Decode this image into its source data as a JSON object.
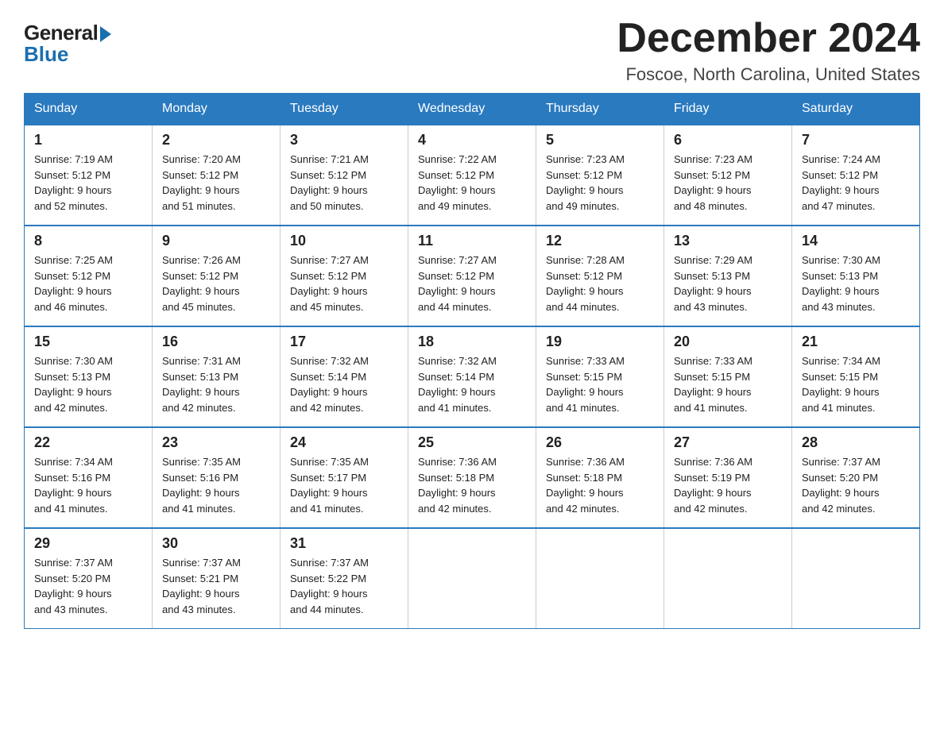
{
  "logo": {
    "general": "General",
    "blue": "Blue"
  },
  "title": "December 2024",
  "subtitle": "Foscoe, North Carolina, United States",
  "days_of_week": [
    "Sunday",
    "Monday",
    "Tuesday",
    "Wednesday",
    "Thursday",
    "Friday",
    "Saturday"
  ],
  "weeks": [
    [
      {
        "day": "1",
        "sunrise": "7:19 AM",
        "sunset": "5:12 PM",
        "daylight": "9 hours and 52 minutes."
      },
      {
        "day": "2",
        "sunrise": "7:20 AM",
        "sunset": "5:12 PM",
        "daylight": "9 hours and 51 minutes."
      },
      {
        "day": "3",
        "sunrise": "7:21 AM",
        "sunset": "5:12 PM",
        "daylight": "9 hours and 50 minutes."
      },
      {
        "day": "4",
        "sunrise": "7:22 AM",
        "sunset": "5:12 PM",
        "daylight": "9 hours and 49 minutes."
      },
      {
        "day": "5",
        "sunrise": "7:23 AM",
        "sunset": "5:12 PM",
        "daylight": "9 hours and 49 minutes."
      },
      {
        "day": "6",
        "sunrise": "7:23 AM",
        "sunset": "5:12 PM",
        "daylight": "9 hours and 48 minutes."
      },
      {
        "day": "7",
        "sunrise": "7:24 AM",
        "sunset": "5:12 PM",
        "daylight": "9 hours and 47 minutes."
      }
    ],
    [
      {
        "day": "8",
        "sunrise": "7:25 AM",
        "sunset": "5:12 PM",
        "daylight": "9 hours and 46 minutes."
      },
      {
        "day": "9",
        "sunrise": "7:26 AM",
        "sunset": "5:12 PM",
        "daylight": "9 hours and 45 minutes."
      },
      {
        "day": "10",
        "sunrise": "7:27 AM",
        "sunset": "5:12 PM",
        "daylight": "9 hours and 45 minutes."
      },
      {
        "day": "11",
        "sunrise": "7:27 AM",
        "sunset": "5:12 PM",
        "daylight": "9 hours and 44 minutes."
      },
      {
        "day": "12",
        "sunrise": "7:28 AM",
        "sunset": "5:12 PM",
        "daylight": "9 hours and 44 minutes."
      },
      {
        "day": "13",
        "sunrise": "7:29 AM",
        "sunset": "5:13 PM",
        "daylight": "9 hours and 43 minutes."
      },
      {
        "day": "14",
        "sunrise": "7:30 AM",
        "sunset": "5:13 PM",
        "daylight": "9 hours and 43 minutes."
      }
    ],
    [
      {
        "day": "15",
        "sunrise": "7:30 AM",
        "sunset": "5:13 PM",
        "daylight": "9 hours and 42 minutes."
      },
      {
        "day": "16",
        "sunrise": "7:31 AM",
        "sunset": "5:13 PM",
        "daylight": "9 hours and 42 minutes."
      },
      {
        "day": "17",
        "sunrise": "7:32 AM",
        "sunset": "5:14 PM",
        "daylight": "9 hours and 42 minutes."
      },
      {
        "day": "18",
        "sunrise": "7:32 AM",
        "sunset": "5:14 PM",
        "daylight": "9 hours and 41 minutes."
      },
      {
        "day": "19",
        "sunrise": "7:33 AM",
        "sunset": "5:15 PM",
        "daylight": "9 hours and 41 minutes."
      },
      {
        "day": "20",
        "sunrise": "7:33 AM",
        "sunset": "5:15 PM",
        "daylight": "9 hours and 41 minutes."
      },
      {
        "day": "21",
        "sunrise": "7:34 AM",
        "sunset": "5:15 PM",
        "daylight": "9 hours and 41 minutes."
      }
    ],
    [
      {
        "day": "22",
        "sunrise": "7:34 AM",
        "sunset": "5:16 PM",
        "daylight": "9 hours and 41 minutes."
      },
      {
        "day": "23",
        "sunrise": "7:35 AM",
        "sunset": "5:16 PM",
        "daylight": "9 hours and 41 minutes."
      },
      {
        "day": "24",
        "sunrise": "7:35 AM",
        "sunset": "5:17 PM",
        "daylight": "9 hours and 41 minutes."
      },
      {
        "day": "25",
        "sunrise": "7:36 AM",
        "sunset": "5:18 PM",
        "daylight": "9 hours and 42 minutes."
      },
      {
        "day": "26",
        "sunrise": "7:36 AM",
        "sunset": "5:18 PM",
        "daylight": "9 hours and 42 minutes."
      },
      {
        "day": "27",
        "sunrise": "7:36 AM",
        "sunset": "5:19 PM",
        "daylight": "9 hours and 42 minutes."
      },
      {
        "day": "28",
        "sunrise": "7:37 AM",
        "sunset": "5:20 PM",
        "daylight": "9 hours and 42 minutes."
      }
    ],
    [
      {
        "day": "29",
        "sunrise": "7:37 AM",
        "sunset": "5:20 PM",
        "daylight": "9 hours and 43 minutes."
      },
      {
        "day": "30",
        "sunrise": "7:37 AM",
        "sunset": "5:21 PM",
        "daylight": "9 hours and 43 minutes."
      },
      {
        "day": "31",
        "sunrise": "7:37 AM",
        "sunset": "5:22 PM",
        "daylight": "9 hours and 44 minutes."
      },
      null,
      null,
      null,
      null
    ]
  ],
  "labels": {
    "sunrise": "Sunrise:",
    "sunset": "Sunset:",
    "daylight": "Daylight:"
  }
}
